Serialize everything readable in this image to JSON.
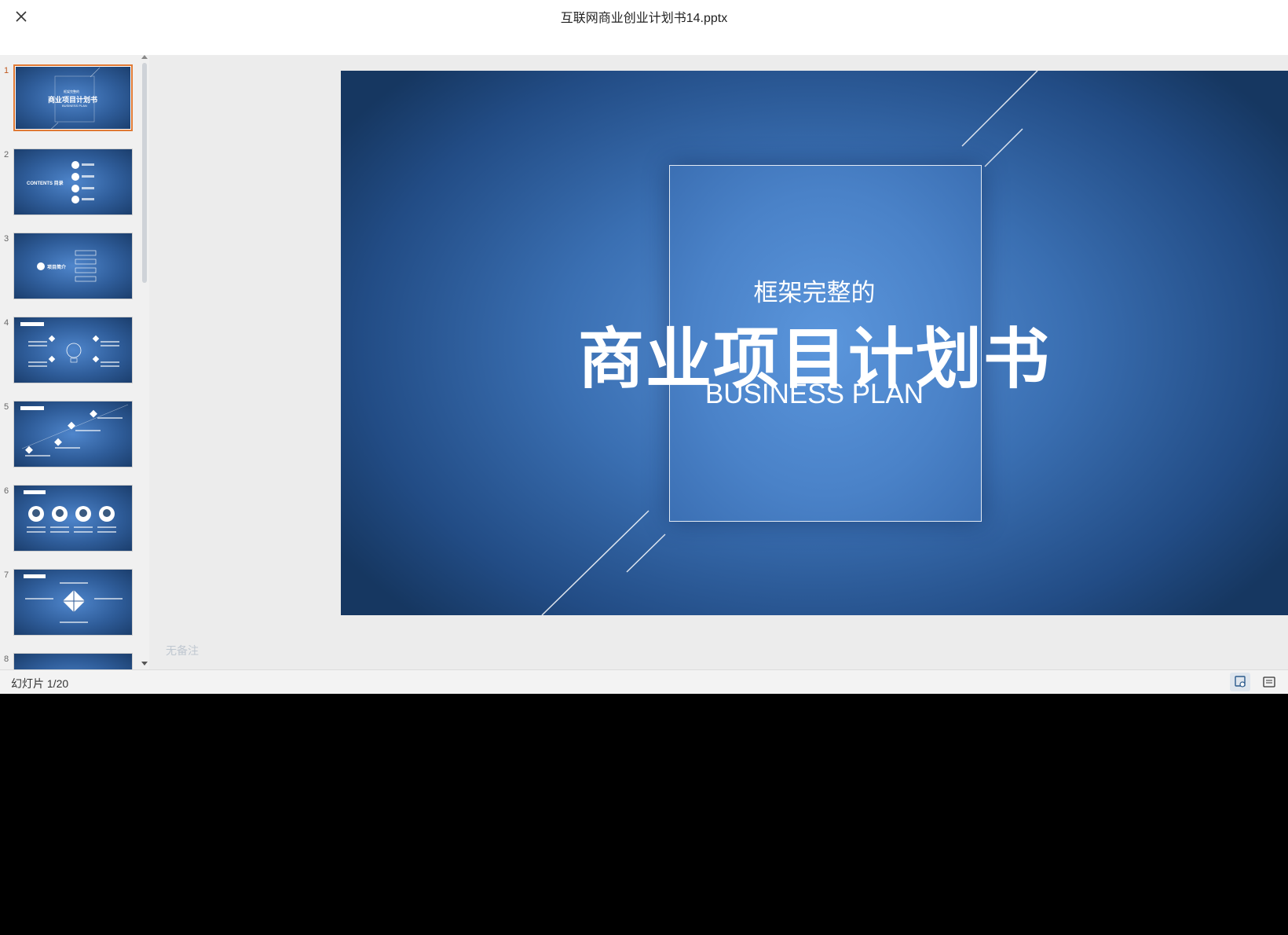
{
  "window": {
    "title": "互联网商业创业计划书14.pptx"
  },
  "thumbnails": [
    {
      "num": "1",
      "lines": [
        "框架完整的",
        "商业项目计划书",
        "BUSINESS PLAN"
      ]
    },
    {
      "num": "2",
      "lines": [
        "CONTENTS 目录"
      ]
    },
    {
      "num": "3",
      "lines": [
        "项目简介"
      ]
    },
    {
      "num": "4",
      "lines": []
    },
    {
      "num": "5",
      "lines": []
    },
    {
      "num": "6",
      "lines": []
    },
    {
      "num": "7",
      "lines": []
    },
    {
      "num": "8",
      "lines": []
    }
  ],
  "slide": {
    "subtitle": "框架完整的",
    "title": "商业项目计划书",
    "english": "BUSINESS PLAN"
  },
  "notes": {
    "placeholder": "无备注"
  },
  "status": {
    "counter": "幻灯片 1/20"
  },
  "colors": {
    "accent": "#e07a35",
    "slide_blue": "#3a6fb2"
  },
  "icons": [
    "close-icon",
    "normal-view-icon",
    "notes-view-icon"
  ]
}
